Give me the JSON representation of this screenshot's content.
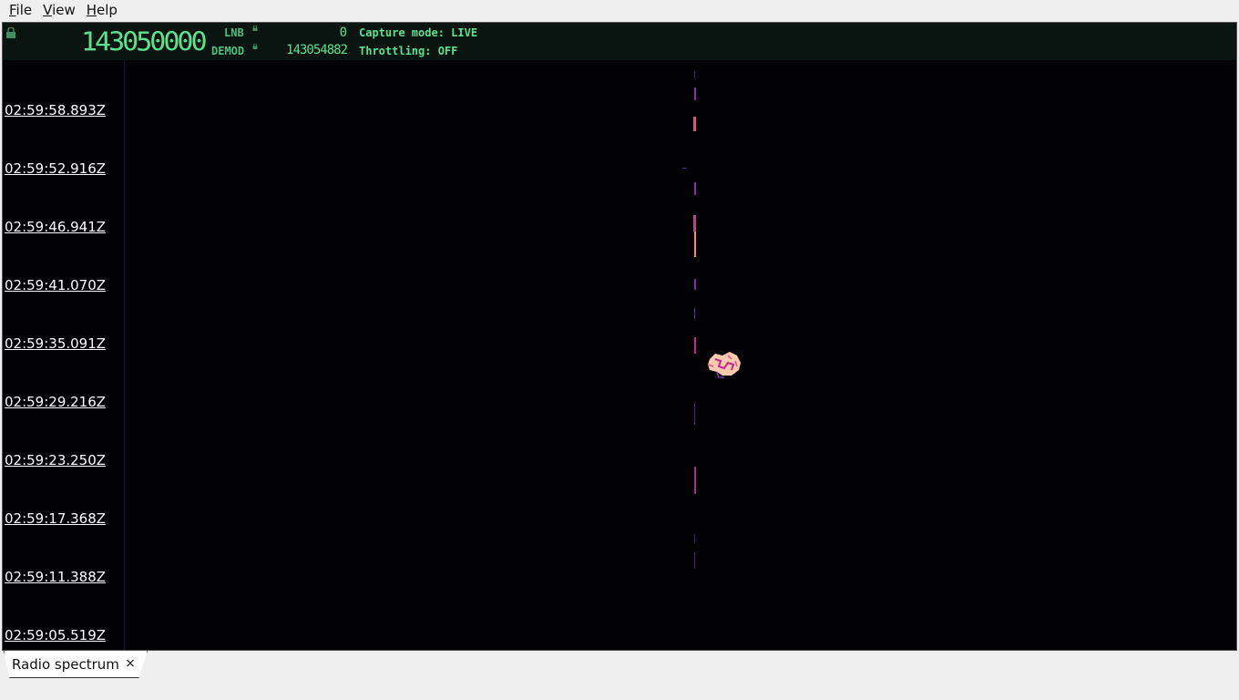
{
  "menu": {
    "items": [
      {
        "mnemonic": "F",
        "rest": "ile"
      },
      {
        "mnemonic": "V",
        "rest": "iew"
      },
      {
        "mnemonic": "H",
        "rest": "elp"
      }
    ]
  },
  "header": {
    "main_frequency": "143050000",
    "lnb_label": "LNB",
    "lnb_value": "0",
    "demod_label": "DEMOD",
    "demod_value": "143054882",
    "capture_mode": "Capture mode: LIVE",
    "throttling": "Throttling: OFF"
  },
  "waterfall": {
    "timestamps": [
      "02:59:58.893Z",
      "02:59:52.916Z",
      "02:59:46.941Z",
      "02:59:41.070Z",
      "02:59:35.091Z",
      "02:59:29.216Z",
      "02:59:23.250Z",
      "02:59:17.368Z",
      "02:59:11.388Z",
      "02:59:05.519Z"
    ]
  },
  "tabs": [
    {
      "label": "Radio spectrum",
      "close": "×"
    }
  ],
  "colors": {
    "digits": "#5fe08f",
    "header_bg": "#0a1410",
    "waterfall_bg": "#020205",
    "signal": "#c02a8a",
    "signal_hot": "#ffc9b0"
  }
}
